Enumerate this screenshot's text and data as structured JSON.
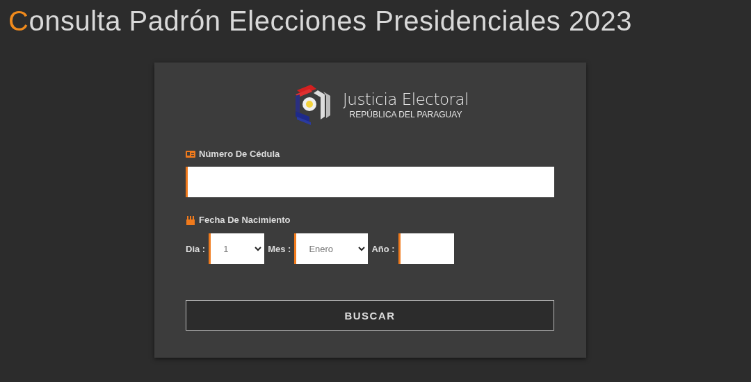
{
  "title": {
    "accent": "C",
    "rest": "onsulta Padrón Elecciones Presidenciales 2023"
  },
  "logo": {
    "name": "Justicia Electoral",
    "subtitle": "REPÚBLICA DEL PARAGUAY"
  },
  "cedula": {
    "label": "Número De Cédula"
  },
  "birth": {
    "label": "Fecha De Nacimiento",
    "fields": [
      {
        "kind": "select",
        "label": "Dia :",
        "value": "1"
      },
      {
        "kind": "select",
        "label": "Mes :",
        "value": "Enero"
      },
      {
        "kind": "input",
        "label": "Año :"
      }
    ]
  },
  "button": "BUSCAR"
}
